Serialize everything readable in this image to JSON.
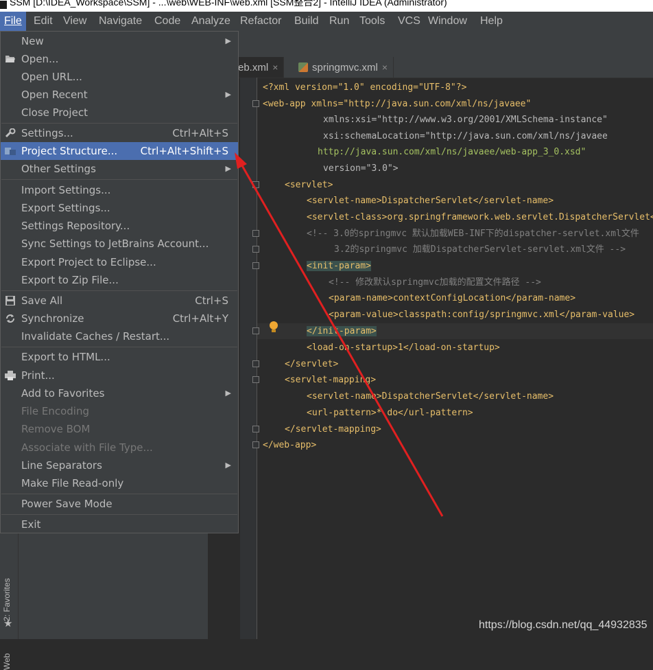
{
  "window": {
    "title": "SSM [D:\\IDEA_Workspace\\SSM] - ...\\web\\WEB-INF\\web.xml [SSM整合2] - IntelliJ IDEA (Administrator)"
  },
  "menubar": {
    "items": [
      "File",
      "Edit",
      "View",
      "Navigate",
      "Code",
      "Analyze",
      "Refactor",
      "Build",
      "Run",
      "Tools",
      "VCS",
      "Window",
      "Help"
    ]
  },
  "tabs": {
    "active": "eb.xml",
    "second": "springmvc.xml",
    "close_glyph": "×"
  },
  "file_menu": {
    "items": [
      {
        "label": "New",
        "shortcut": "",
        "submenu": true
      },
      {
        "label": "Open...",
        "shortcut": ""
      },
      {
        "label": "Open URL...",
        "shortcut": ""
      },
      {
        "label": "Open Recent",
        "shortcut": "",
        "submenu": true
      },
      {
        "label": "Close Project",
        "shortcut": ""
      },
      {
        "label": "Settings...",
        "shortcut": "Ctrl+Alt+S"
      },
      {
        "label": "Project Structure...",
        "shortcut": "Ctrl+Alt+Shift+S",
        "selected": true
      },
      {
        "label": "Other Settings",
        "shortcut": "",
        "submenu": true
      },
      {
        "label": "Import Settings...",
        "shortcut": ""
      },
      {
        "label": "Export Settings...",
        "shortcut": ""
      },
      {
        "label": "Settings Repository...",
        "shortcut": ""
      },
      {
        "label": "Sync Settings to JetBrains Account...",
        "shortcut": ""
      },
      {
        "label": "Export Project to Eclipse...",
        "shortcut": ""
      },
      {
        "label": "Export to Zip File...",
        "shortcut": ""
      },
      {
        "label": "Save All",
        "shortcut": "Ctrl+S"
      },
      {
        "label": "Synchronize",
        "shortcut": "Ctrl+Alt+Y"
      },
      {
        "label": "Invalidate Caches / Restart...",
        "shortcut": ""
      },
      {
        "label": "Export to HTML...",
        "shortcut": ""
      },
      {
        "label": "Print...",
        "shortcut": ""
      },
      {
        "label": "Add to Favorites",
        "shortcut": "",
        "submenu": true
      },
      {
        "label": "File Encoding",
        "shortcut": "",
        "disabled": true
      },
      {
        "label": "Remove BOM",
        "shortcut": "",
        "disabled": true
      },
      {
        "label": "Associate with File Type...",
        "shortcut": "",
        "disabled": true
      },
      {
        "label": "Line Separators",
        "shortcut": "",
        "submenu": true
      },
      {
        "label": "Make File Read-only",
        "shortcut": ""
      },
      {
        "label": "Power Save Mode",
        "shortcut": ""
      },
      {
        "label": "Exit",
        "shortcut": ""
      }
    ]
  },
  "code": {
    "lines": [
      "<?xml version=\"1.0\" encoding=\"UTF-8\"?>",
      "<web-app xmlns=\"http://java.sun.com/xml/ns/javaee\"",
      "xmlns:xsi=\"http://www.w3.org/2001/XMLSchema-instance\"",
      "xsi:schemaLocation=\"http://java.sun.com/xml/ns/javaee",
      "http://java.sun.com/xml/ns/javaee/web-app_3_0.xsd\"",
      "version=\"3.0\">",
      "<servlet>",
      "<servlet-name>DispatcherServlet</servlet-name>",
      "<servlet-class>org.springframework.web.servlet.DispatcherServlet</servlet-class>",
      "<!-- 3.0的springmvc 默认加载WEB-INF下的dispatcher-servlet.xml文件",
      "3.2的springmvc 加载DispatcherServlet-servlet.xml文件 -->",
      "<init-param>",
      "<!-- 修改默认springmvc加载的配置文件路径 -->",
      "<param-name>contextConfigLocation</param-name>",
      "<param-value>classpath:config/springmvc.xml</param-value>",
      "</init-param>",
      "<load-on-startup>1</load-on-startup>",
      "</servlet>",
      "<servlet-mapping>",
      "<servlet-name>DispatcherServlet</servlet-name>",
      "<url-pattern>*.do</url-pattern>",
      "</servlet-mapping>",
      "</web-app>"
    ]
  },
  "side_tools": {
    "favorites": "2: Favorites",
    "web": "Web"
  },
  "watermark": "https://blog.csdn.net/qq_44932835",
  "colors": {
    "menu_bg": "#3c3f41",
    "selection": "#4b6eaf",
    "editor_bg": "#2b2b2b",
    "annotation_arrow": "#e02020"
  }
}
